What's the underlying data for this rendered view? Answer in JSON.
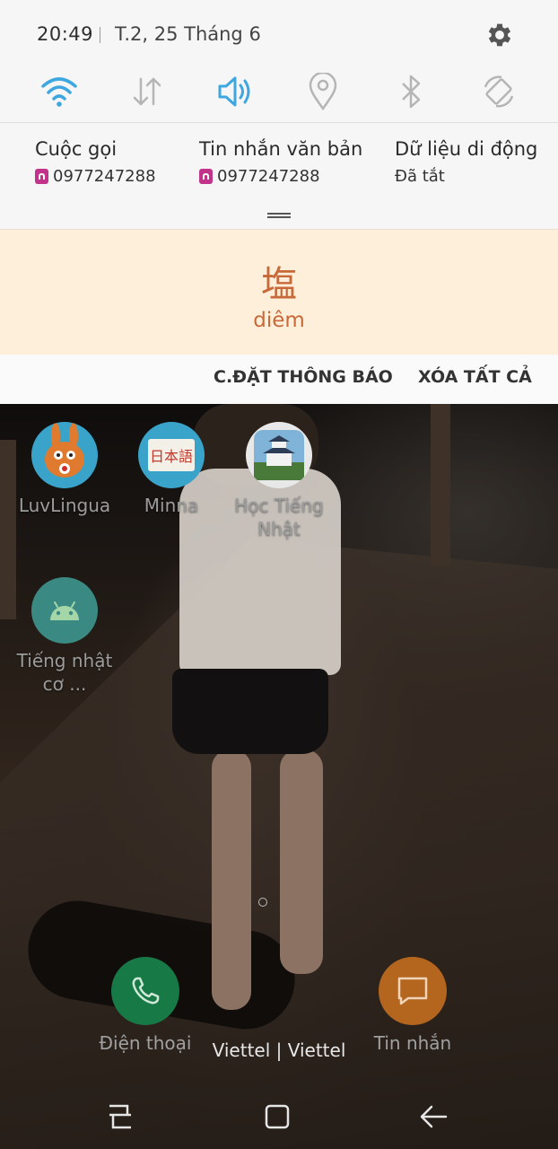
{
  "status_bar": {
    "time": "20:49",
    "date": "T.2, 25 Tháng 6"
  },
  "quick_settings": [
    "wifi-icon",
    "mobile-data-icon",
    "sound-icon",
    "location-icon",
    "bluetooth-icon",
    "auto-rotate-icon"
  ],
  "accent_color": "#3fa7e0",
  "info": {
    "calls": {
      "title": "Cuộc gọi",
      "value": "0977247288"
    },
    "messages": {
      "title": "Tin nhắn văn bản",
      "value": "0977247288"
    },
    "mobile_data": {
      "title": "Dữ liệu di động",
      "value": "Đã tắt"
    }
  },
  "notification": {
    "kanji": "塩",
    "reading": "diêm",
    "color": "#c8693a"
  },
  "actions": {
    "settings": "C.ĐẶT THÔNG BÁO",
    "clear_all": "XÓA TẤT CẢ"
  },
  "home": {
    "apps": [
      {
        "label": "LuvLingua"
      },
      {
        "label": "Minna"
      },
      {
        "label": "Học Tiếng Nhật"
      },
      {
        "label": "Tiếng nhật cơ ..."
      }
    ],
    "minna_icon_text": "日本語",
    "dock": {
      "phone": "Điện thoại",
      "messages": "Tin nhắn"
    },
    "carrier": "Viettel | Viettel"
  }
}
